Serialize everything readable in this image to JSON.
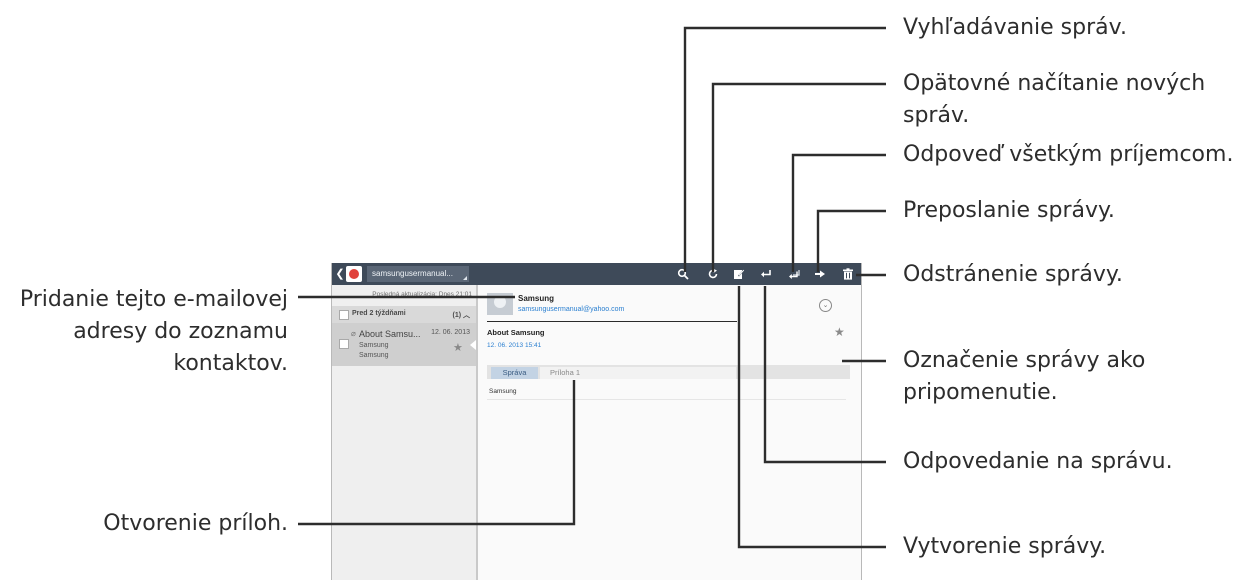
{
  "app": {
    "account_label": "samsungusermanual...",
    "last_update": "Posledná aktualizácia: Dnes 21:01",
    "group": {
      "label": "Pred 2 týždňami",
      "count": "(1)"
    },
    "mail_item": {
      "subject": "About Samsu...",
      "date": "12. 06. 2013",
      "line1": "Samsung",
      "line2": "Samsung"
    },
    "message": {
      "sender_name": "Samsung",
      "sender_email": "samsungusermanual@yahoo.com",
      "subject": "About Samsung",
      "datetime": "12. 06. 2013 15:41",
      "tabs": [
        "Správa",
        "Príloha 1"
      ],
      "body": "Samsung"
    },
    "toolbar_icons": [
      "back-icon",
      "email-app-icon",
      "search-icon",
      "refresh-icon",
      "compose-icon",
      "reply-icon",
      "reply-all-icon",
      "forward-icon",
      "delete-icon",
      "star-icon",
      "chevron-down-icon",
      "paperclip-icon"
    ],
    "colors": {
      "topbar": "#3e4a59",
      "link": "#2a7fd0",
      "active_tab": "#c3d3e4"
    }
  },
  "callouts": {
    "search": "Vyhľadávanie správ.",
    "refresh_line1": "Opätovné načítanie nových",
    "refresh_line2": "správ.",
    "reply_all": "Odpoveď všetkým príjemcom.",
    "forward": "Preposlanie správy.",
    "delete": "Odstránenie správy.",
    "star_line1": "Označenie správy ako",
    "star_line2": "pripomenutie.",
    "reply": "Odpovedanie na správu.",
    "compose": "Vytvorenie správy.",
    "add_contact_line1": "Pridanie tejto e-mailovej",
    "add_contact_line2": "adresy do zoznamu",
    "add_contact_line3": "kontaktov.",
    "attachments": "Otvorenie príloh."
  }
}
